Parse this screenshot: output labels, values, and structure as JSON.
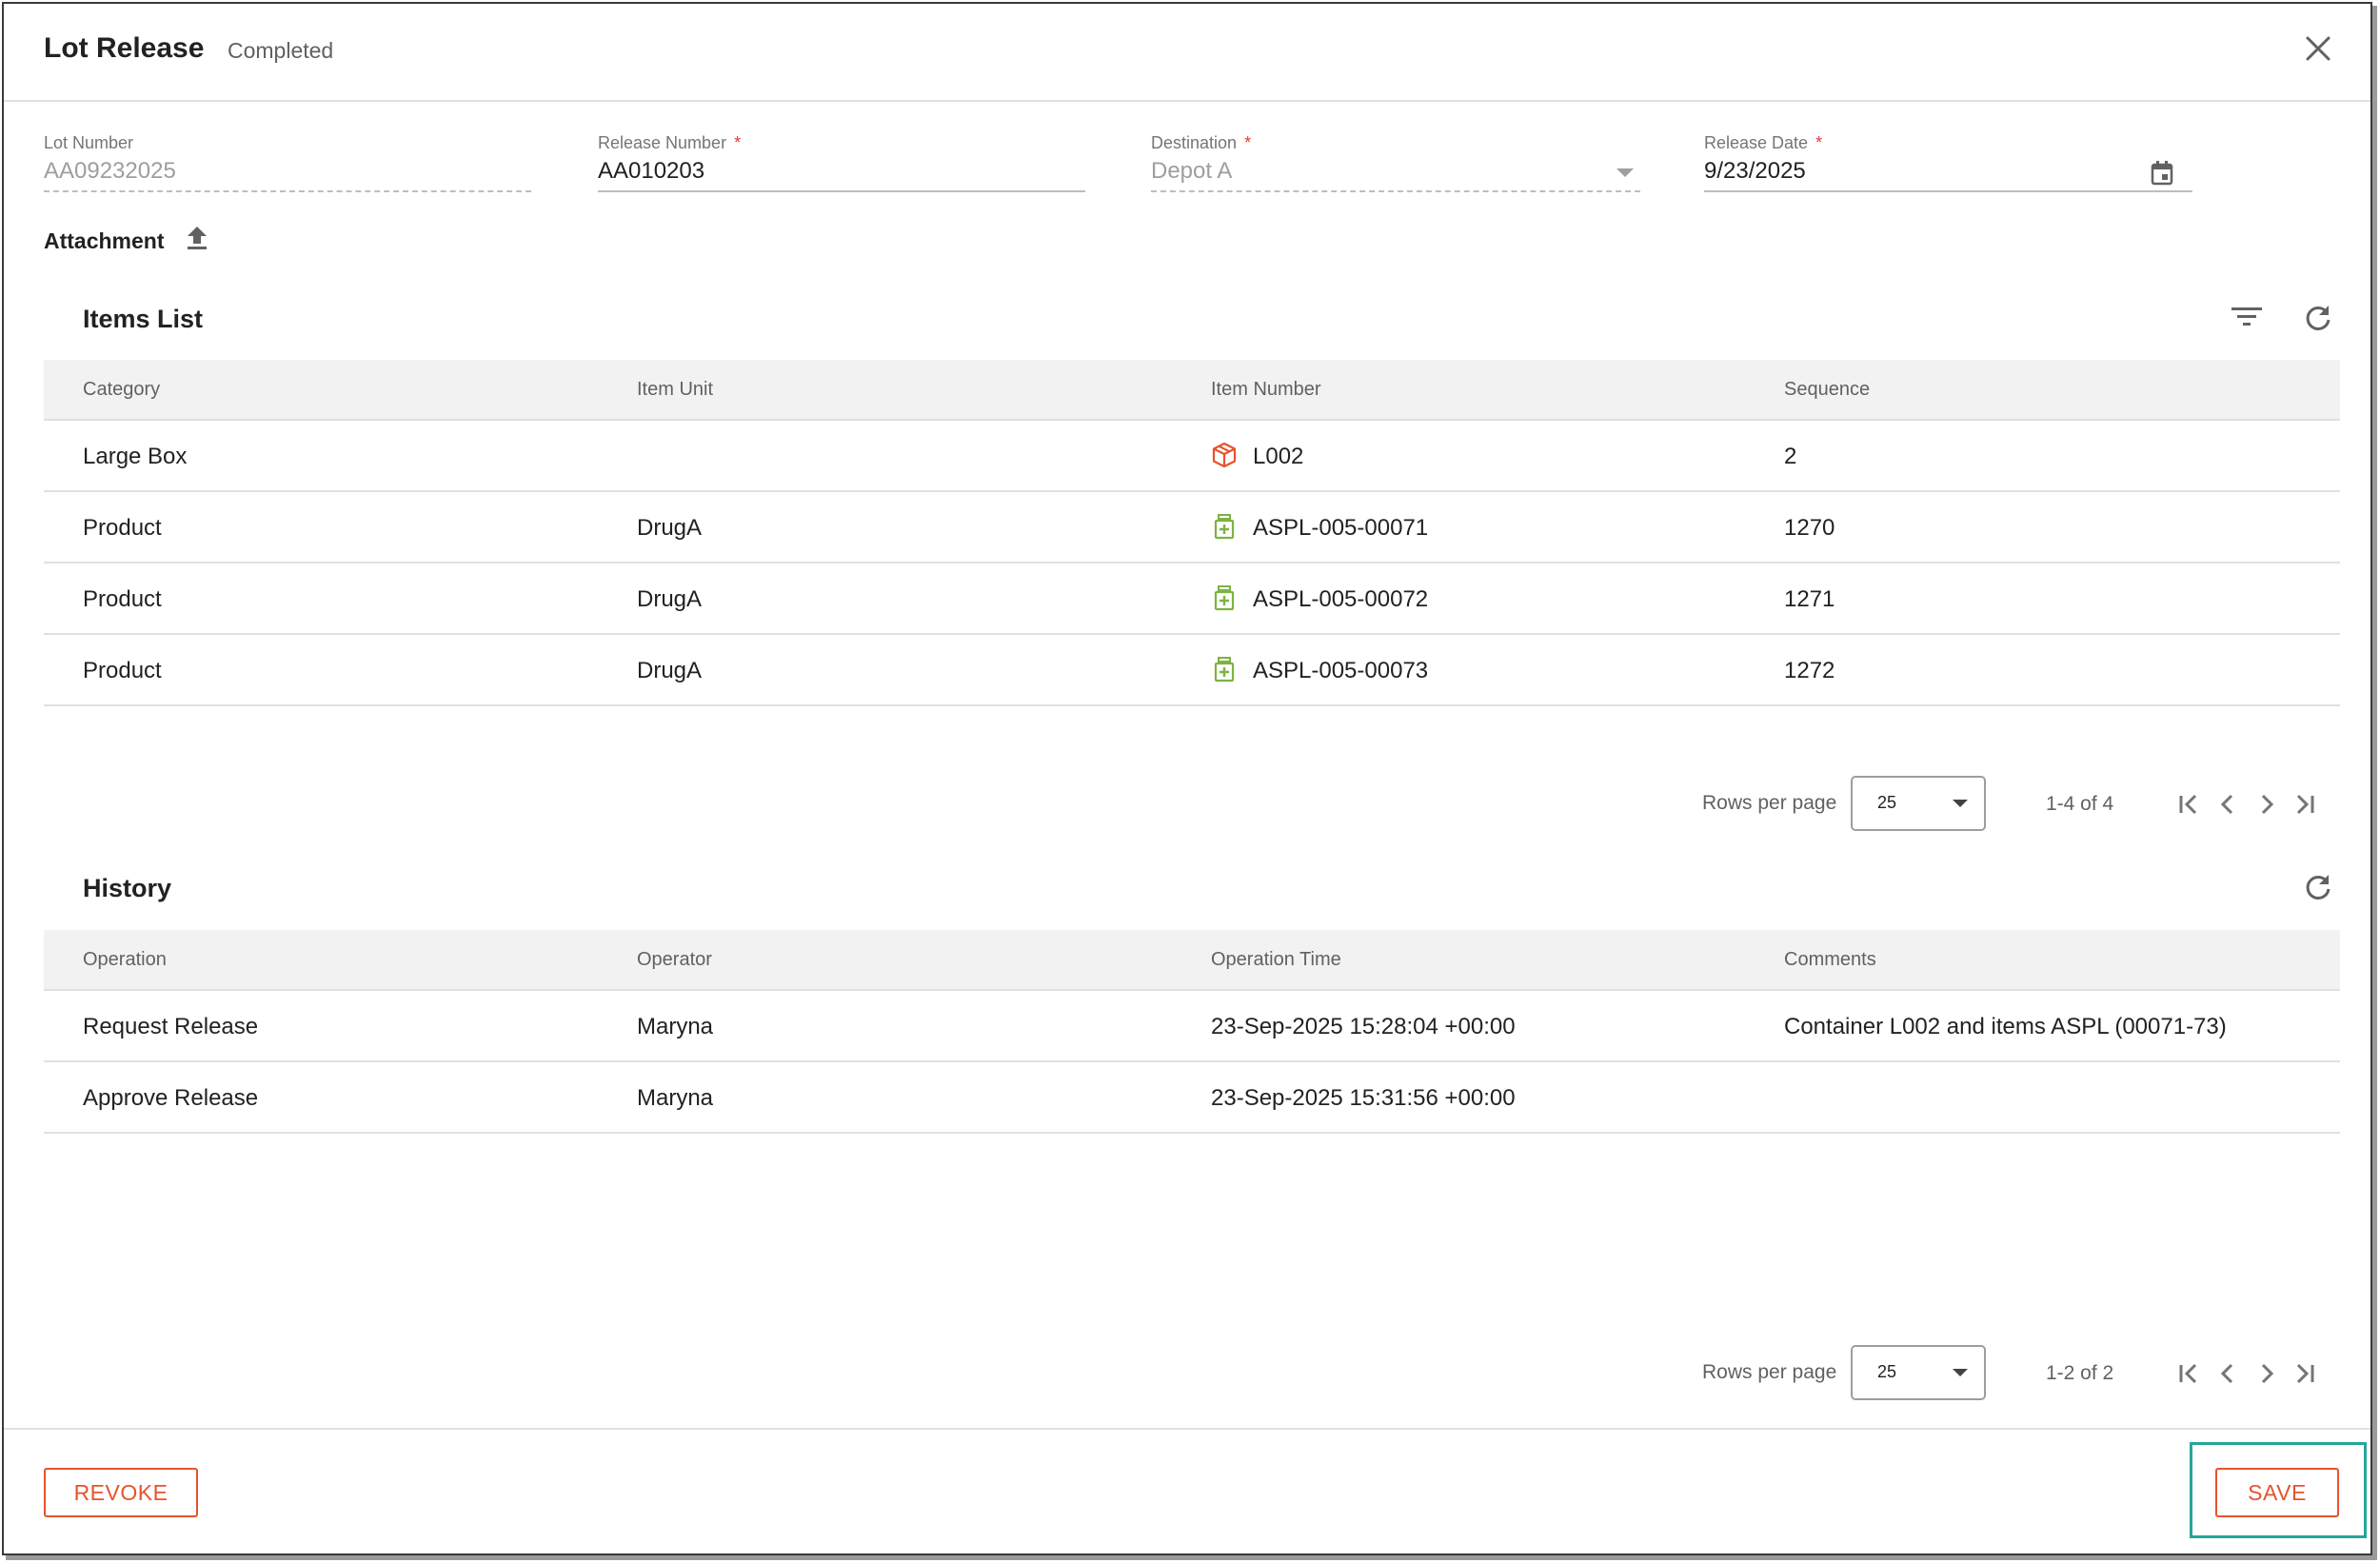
{
  "header": {
    "title": "Lot Release",
    "status": "Completed"
  },
  "fields": {
    "lot_number": {
      "label": "Lot Number",
      "value": "AA09232025"
    },
    "release_number": {
      "label": "Release Number",
      "value": "AA010203",
      "required_mark": "*"
    },
    "destination": {
      "label": "Destination",
      "value": "Depot A",
      "required_mark": "*"
    },
    "release_date": {
      "label": "Release Date",
      "value": "9/23/2025",
      "required_mark": "*"
    }
  },
  "attachment": {
    "label": "Attachment"
  },
  "items_list": {
    "title": "Items List",
    "columns": [
      "Category",
      "Item Unit",
      "Item Number",
      "Sequence"
    ],
    "rows": [
      {
        "category": "Large Box",
        "item_unit": "",
        "item_number": "L002",
        "sequence": "2",
        "icon": "box-icon"
      },
      {
        "category": "Product",
        "item_unit": "DrugA",
        "item_number": "ASPL-005-00071",
        "sequence": "1270",
        "icon": "medicine-bottle-icon"
      },
      {
        "category": "Product",
        "item_unit": "DrugA",
        "item_number": "ASPL-005-00072",
        "sequence": "1271",
        "icon": "medicine-bottle-icon"
      },
      {
        "category": "Product",
        "item_unit": "DrugA",
        "item_number": "ASPL-005-00073",
        "sequence": "1272",
        "icon": "medicine-bottle-icon"
      }
    ],
    "pagination": {
      "rows_per_page_label": "Rows per page",
      "rows_per_page": "25",
      "range": "1-4 of 4"
    }
  },
  "history": {
    "title": "History",
    "columns": [
      "Operation",
      "Operator",
      "Operation Time",
      "Comments"
    ],
    "rows": [
      {
        "operation": "Request Release",
        "operator": "Maryna",
        "time": "23-Sep-2025 15:28:04 +00:00",
        "comments": "Container L002 and items ASPL (00071-73)"
      },
      {
        "operation": "Approve Release",
        "operator": "Maryna",
        "time": "23-Sep-2025 15:31:56 +00:00",
        "comments": ""
      }
    ],
    "pagination": {
      "rows_per_page_label": "Rows per page",
      "rows_per_page": "25",
      "range": "1-2 of 2"
    }
  },
  "footer": {
    "revoke_label": "REVOKE",
    "save_label": "SAVE"
  },
  "colors": {
    "accent": "#e6532d",
    "box_icon": "#e6532d",
    "medicine_icon": "#7cb342",
    "highlight": "#26a69a",
    "required": "#e53935"
  }
}
